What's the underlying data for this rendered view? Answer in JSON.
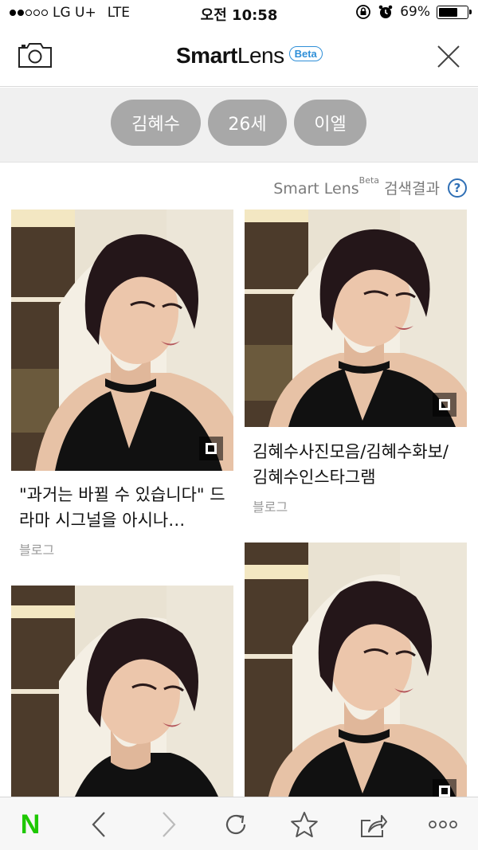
{
  "status_bar": {
    "carrier": "LG U+",
    "network": "LTE",
    "time": "오전 10:58",
    "battery": "69%",
    "battery_level": 0.69
  },
  "header": {
    "logo_bold": "Smart",
    "logo_light": "Lens",
    "beta_label": "Beta"
  },
  "tags": [
    "김혜수",
    "26세",
    "이엘"
  ],
  "results": {
    "label_main": "Smart Lens",
    "label_sup": "Beta",
    "label_tail": " 검색결과",
    "help_symbol": "?"
  },
  "cards": [
    {
      "title": "\"과거는 바뀔 수 있습니다\" 드라마 시그널을 아시나…",
      "source": "블로그"
    },
    {
      "title": "김혜수사진모음/김혜수화보/김혜수인스타그램",
      "source": "블로그"
    },
    {
      "title": "",
      "source": ""
    },
    {
      "title": "",
      "source": ""
    }
  ],
  "toolbar": {
    "home_icon": "naver-n-icon",
    "home_label": "N",
    "items": [
      "back-icon",
      "forward-icon",
      "reload-icon",
      "star-icon",
      "share-icon",
      "more-icon"
    ]
  },
  "colors": {
    "accent": "#2f8fd8",
    "tag_bg": "#a8a8a8",
    "naver_green": "#1ec800"
  }
}
